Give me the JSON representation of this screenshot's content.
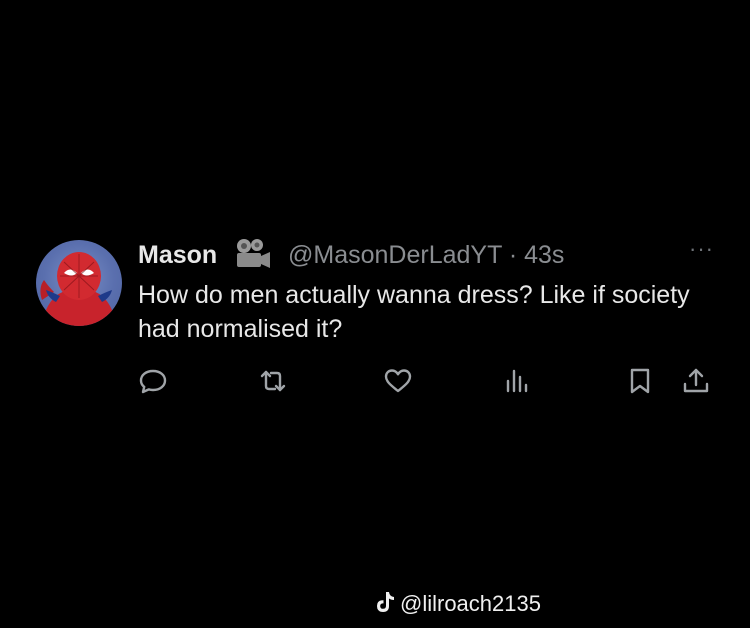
{
  "tweet": {
    "display_name": "Mason",
    "handle_time": "@MasonDerLadYT · 43s",
    "text": "How do men actually wanna dress? Like if society had normalised it?",
    "more_label": "···"
  },
  "icons": {
    "badge": "camera-badge-icon",
    "more": "more-options-icon",
    "reply": "reply-icon",
    "retweet": "retweet-icon",
    "like": "like-icon",
    "views": "views-icon",
    "bookmark": "bookmark-icon",
    "share": "share-icon"
  },
  "watermark": {
    "handle": "@lilroach2135"
  },
  "colors": {
    "background": "#000000",
    "text": "#e8e8e8",
    "secondary": "#8a8d91",
    "icon": "#8a8d91"
  }
}
